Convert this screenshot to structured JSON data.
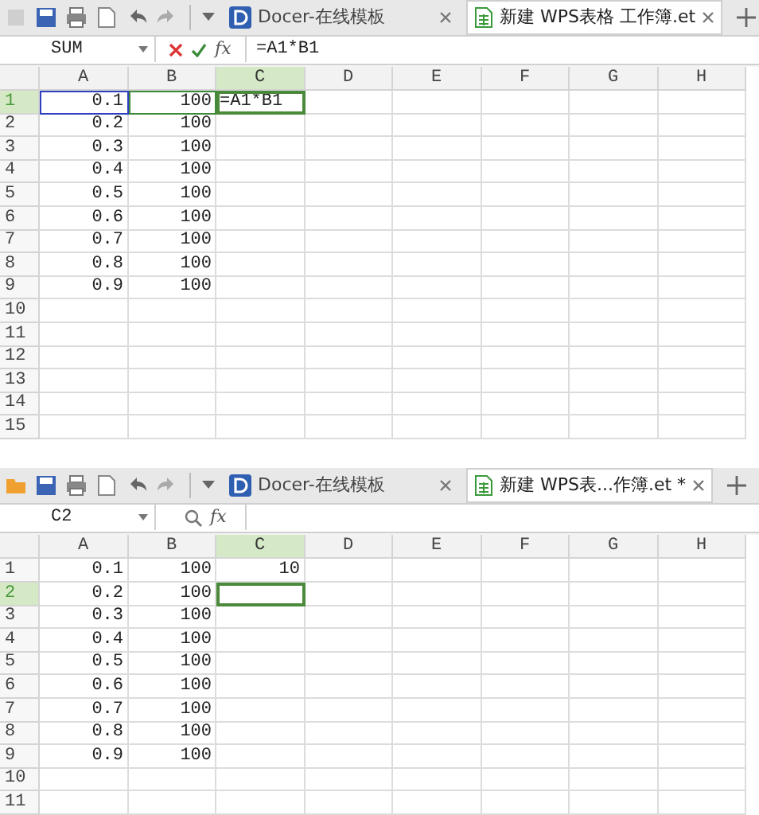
{
  "panels": [
    {
      "tabs": [
        {
          "kind": "docer",
          "label": "Docer-在线模板",
          "selected": false
        },
        {
          "kind": "sheet",
          "label": "新建 WPS表格 工作簿.et",
          "selected": true
        }
      ],
      "name_box": "SUM",
      "editing": true,
      "fx": "fx",
      "formula": "=A1*B1",
      "columns": [
        {
          "label": "A",
          "selected": false
        },
        {
          "label": "B",
          "selected": false
        },
        {
          "label": "C",
          "selected": true
        },
        {
          "label": "D",
          "selected": false
        },
        {
          "label": "E",
          "selected": false
        },
        {
          "label": "F",
          "selected": false
        },
        {
          "label": "G",
          "selected": false
        },
        {
          "label": "H",
          "selected": false
        }
      ],
      "rows": [
        {
          "header": "1",
          "selected": true,
          "cells": [
            {
              "text": "0.1",
              "color": "#2f3fc0"
            },
            {
              "text": "100",
              "color": "#3e8a3a"
            },
            {
              "text": "=A1*B1"
            }
          ]
        },
        {
          "header": "2",
          "selected": false,
          "cells": [
            {
              "text": "0.2"
            },
            {
              "text": "100"
            }
          ]
        },
        {
          "header": "3",
          "selected": false,
          "cells": [
            {
              "text": "0.3"
            },
            {
              "text": "100"
            }
          ]
        },
        {
          "header": "4",
          "selected": false,
          "cells": [
            {
              "text": "0.4"
            },
            {
              "text": "100"
            }
          ]
        },
        {
          "header": "5",
          "selected": false,
          "cells": [
            {
              "text": "0.5"
            },
            {
              "text": "100"
            }
          ]
        },
        {
          "header": "6",
          "selected": false,
          "cells": [
            {
              "text": "0.6"
            },
            {
              "text": "100"
            }
          ]
        },
        {
          "header": "7",
          "selected": false,
          "cells": [
            {
              "text": "0.7"
            },
            {
              "text": "100"
            }
          ]
        },
        {
          "header": "8",
          "selected": false,
          "cells": [
            {
              "text": "0.8"
            },
            {
              "text": "100"
            }
          ]
        },
        {
          "header": "9",
          "selected": false,
          "cells": [
            {
              "text": "0.9"
            },
            {
              "text": "100"
            }
          ]
        },
        {
          "header": "10",
          "selected": false
        },
        {
          "header": "11",
          "selected": false
        },
        {
          "header": "12",
          "selected": false
        },
        {
          "header": "13",
          "selected": false
        },
        {
          "header": "14",
          "selected": false
        },
        {
          "header": "15",
          "selected": false
        }
      ]
    },
    {
      "tabs": [
        {
          "kind": "docer",
          "label": "Docer-在线模板",
          "selected": false
        },
        {
          "kind": "sheet",
          "label": "新建 WPS表...作簿.et *",
          "selected": true
        }
      ],
      "name_box": "C2",
      "editing": false,
      "fx": "fx",
      "columns": [
        {
          "label": "A",
          "selected": false
        },
        {
          "label": "B",
          "selected": false
        },
        {
          "label": "C",
          "selected": true
        },
        {
          "label": "D",
          "selected": false
        },
        {
          "label": "E",
          "selected": false
        },
        {
          "label": "F",
          "selected": false
        },
        {
          "label": "G",
          "selected": false
        },
        {
          "label": "H",
          "selected": false
        }
      ],
      "rows": [
        {
          "header": "1",
          "selected": false,
          "cells": [
            {
              "text": "0.1"
            },
            {
              "text": "100"
            },
            {
              "text": "10"
            }
          ]
        },
        {
          "header": "2",
          "selected": true,
          "cells": [
            {
              "text": "0.2"
            },
            {
              "text": "100"
            }
          ]
        },
        {
          "header": "3",
          "selected": false,
          "cells": [
            {
              "text": "0.3"
            },
            {
              "text": "100"
            }
          ]
        },
        {
          "header": "4",
          "selected": false,
          "cells": [
            {
              "text": "0.4"
            },
            {
              "text": "100"
            }
          ]
        },
        {
          "header": "5",
          "selected": false,
          "cells": [
            {
              "text": "0.5"
            },
            {
              "text": "100"
            }
          ]
        },
        {
          "header": "6",
          "selected": false,
          "cells": [
            {
              "text": "0.6"
            },
            {
              "text": "100"
            }
          ]
        },
        {
          "header": "7",
          "selected": false,
          "cells": [
            {
              "text": "0.7"
            },
            {
              "text": "100"
            }
          ]
        },
        {
          "header": "8",
          "selected": false,
          "cells": [
            {
              "text": "0.8"
            },
            {
              "text": "100"
            }
          ]
        },
        {
          "header": "9",
          "selected": false,
          "cells": [
            {
              "text": "0.9"
            },
            {
              "text": "100"
            }
          ]
        },
        {
          "header": "10",
          "selected": false
        },
        {
          "header": "11",
          "selected": false
        }
      ]
    }
  ]
}
